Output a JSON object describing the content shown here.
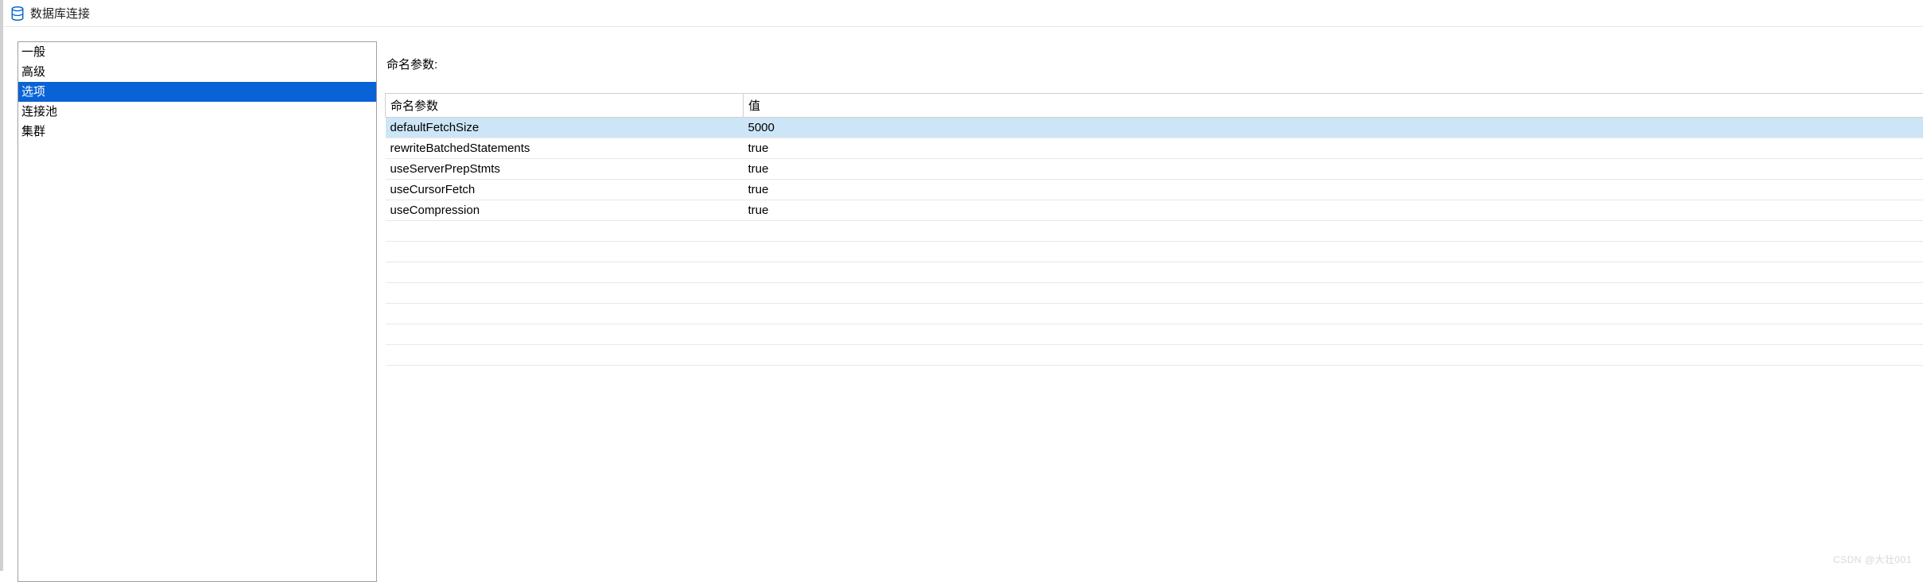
{
  "window": {
    "title": "数据库连接"
  },
  "sidebar": {
    "items": [
      {
        "label": "一般"
      },
      {
        "label": "高级"
      },
      {
        "label": "选项"
      },
      {
        "label": "连接池"
      },
      {
        "label": "集群"
      }
    ],
    "selected_index": 2
  },
  "main": {
    "section_label": "命名参数:",
    "table": {
      "columns": {
        "name": "命名参数",
        "value": "值"
      },
      "rows": [
        {
          "name": "defaultFetchSize",
          "value": "5000"
        },
        {
          "name": "rewriteBatchedStatements",
          "value": "true"
        },
        {
          "name": "useServerPrepStmts",
          "value": "true"
        },
        {
          "name": "useCursorFetch",
          "value": "true"
        },
        {
          "name": "useCompression",
          "value": "true"
        }
      ],
      "selected_row_index": 0
    }
  },
  "watermark": "CSDN @大壮001"
}
